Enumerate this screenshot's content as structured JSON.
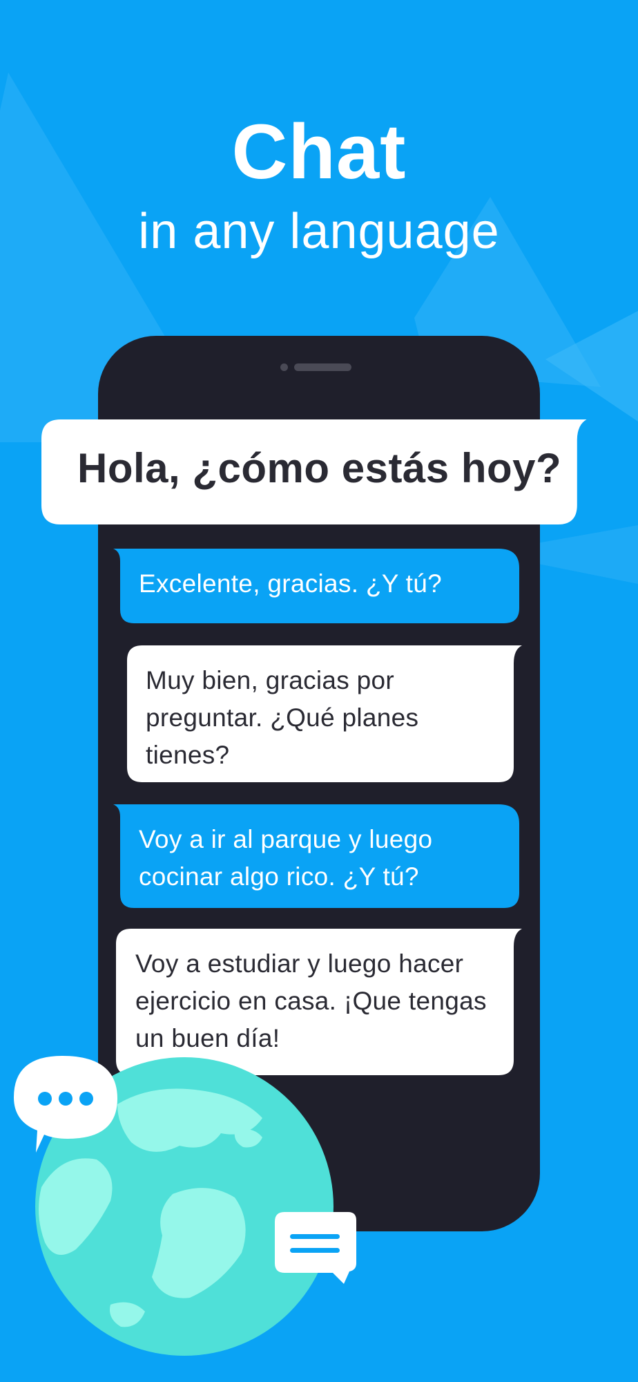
{
  "header": {
    "title": "Chat",
    "subtitle": "in any language"
  },
  "conversation": {
    "highlight": "Hola, ¿cómo estás hoy?",
    "messages": [
      {
        "side": "sent",
        "text": "Excelente, gracias. ¿Y tú?"
      },
      {
        "side": "received",
        "text": "Muy bien, gracias por\npreguntar. ¿Qué planes\ntienes?"
      },
      {
        "side": "sent",
        "text": "Voy a ir al parque y luego\ncocinar algo rico. ¿Y tú?"
      },
      {
        "side": "received",
        "text": "Voy a estudiar y luego hacer\nejercicio en casa. ¡Que tengas\nun buen día!"
      }
    ]
  },
  "decorations": {
    "icons": [
      "globe-icon",
      "typing-bubble-icon",
      "text-bubble-icon"
    ]
  },
  "colors": {
    "background": "#0aa3f5",
    "phone": "#1f1f2b",
    "sent_bubble": "#0aa3f5",
    "received_bubble": "#ffffff",
    "globe": "#4fe0d8",
    "globe_land": "#95f7ea"
  }
}
